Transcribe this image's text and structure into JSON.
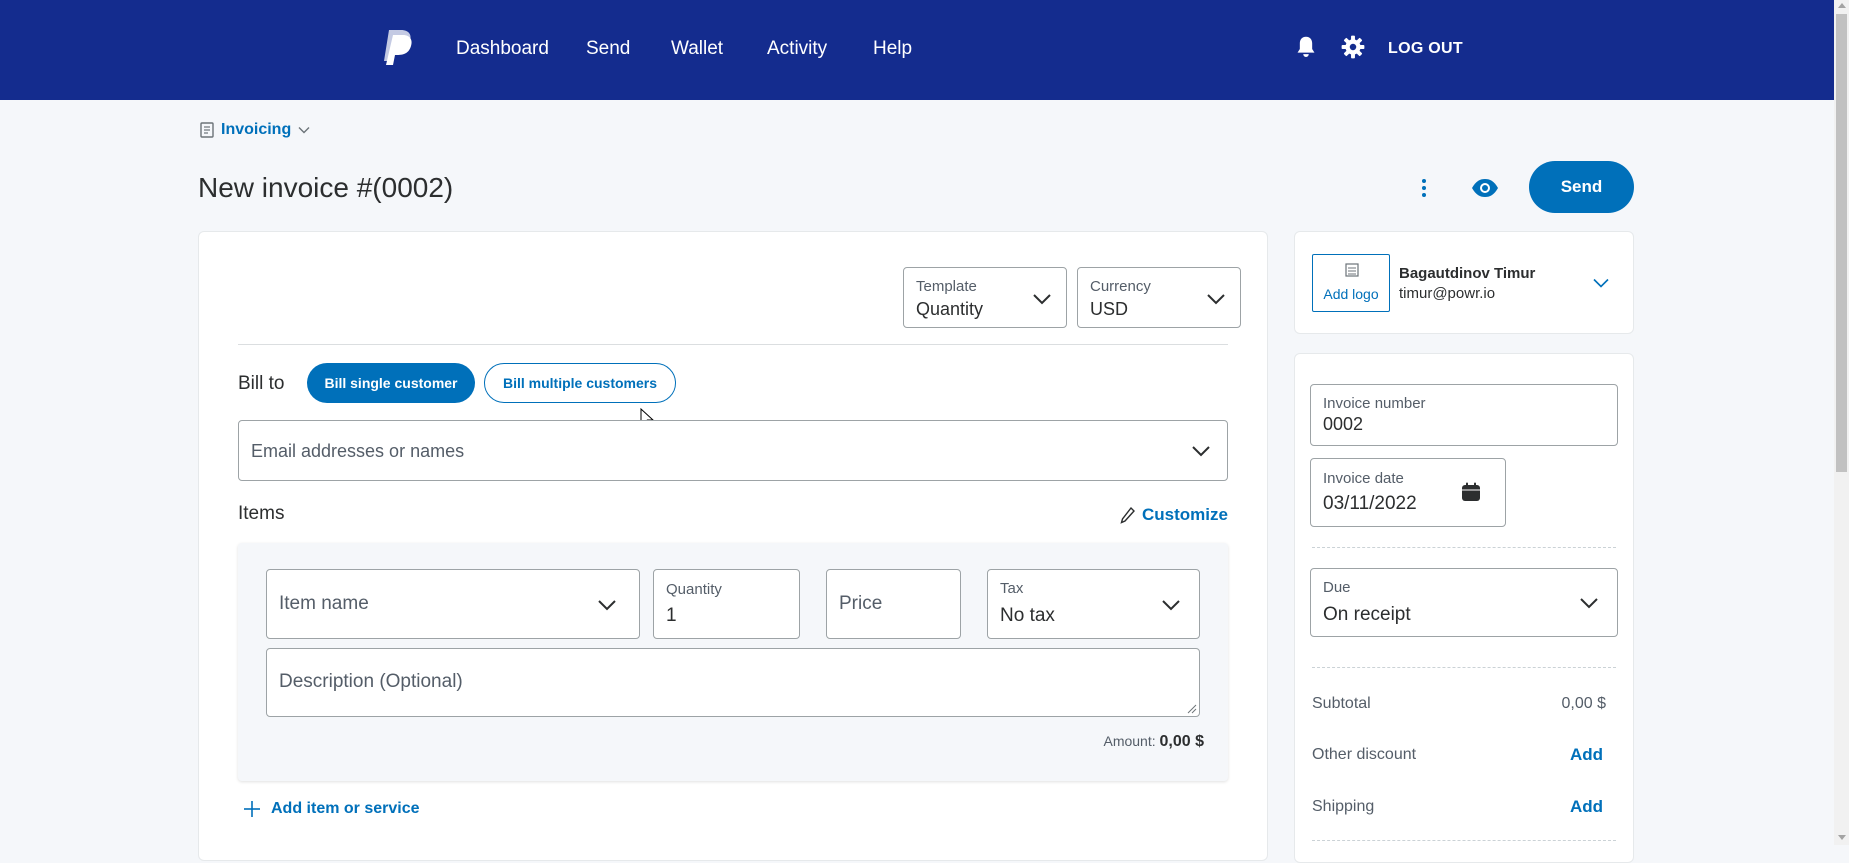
{
  "nav": {
    "items": [
      "Dashboard",
      "Send",
      "Wallet",
      "Activity",
      "Help"
    ],
    "logout_label": "LOG OUT",
    "icons": [
      "paypal-logo",
      "bell-icon",
      "gear-icon"
    ]
  },
  "breadcrumb": {
    "label": "Invoicing"
  },
  "page": {
    "title": "New invoice #(0002)",
    "send_label": "Send"
  },
  "settings": {
    "template_label": "Template",
    "template_value": "Quantity",
    "currency_label": "Currency",
    "currency_value": "USD"
  },
  "bill_to": {
    "label": "Bill to",
    "single_label": "Bill single customer",
    "multiple_label": "Bill multiple customers",
    "email_placeholder": "Email addresses or names"
  },
  "items": {
    "heading": "Items",
    "customize_label": "Customize",
    "item_name_placeholder": "Item name",
    "quantity_label": "Quantity",
    "quantity_value": "1",
    "price_placeholder": "Price",
    "tax_label": "Tax",
    "tax_value": "No tax",
    "description_placeholder": "Description (Optional)",
    "amount_label": "Amount:",
    "amount_value": "0,00 $",
    "add_item_label": "Add item or service"
  },
  "business": {
    "add_logo_label": "Add logo",
    "name": "Bagautdinov Timur",
    "email": "timur@powr.io"
  },
  "invoice_meta": {
    "number_label": "Invoice number",
    "number_value": "0002",
    "date_label": "Invoice date",
    "date_value": "03/11/2022",
    "due_label": "Due",
    "due_value": "On receipt"
  },
  "summary": {
    "subtotal_label": "Subtotal",
    "subtotal_value": "0,00 $",
    "discount_label": "Other discount",
    "discount_action": "Add",
    "shipping_label": "Shipping",
    "shipping_action": "Add"
  },
  "colors": {
    "nav_bg": "#142c8e",
    "primary": "#0070ba",
    "page_bg": "#f5f7fa"
  }
}
